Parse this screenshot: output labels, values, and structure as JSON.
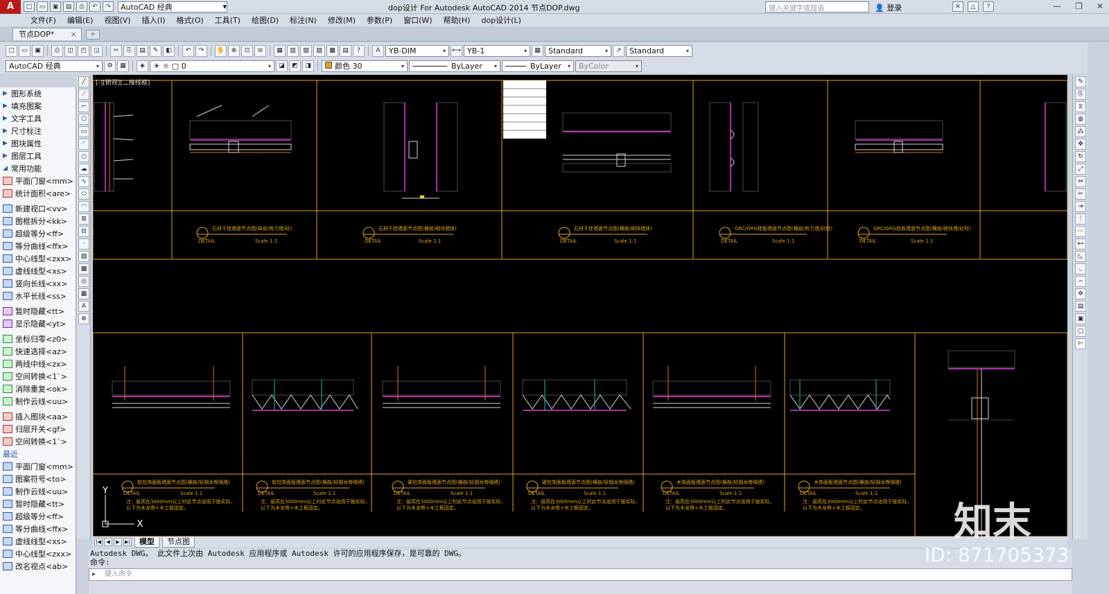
{
  "titlebar": {
    "workspace": "AutoCAD 经典",
    "title": "dop设计 For Autodesk AutoCAD 2014     节点DOP.dwg",
    "search_placeholder": "键入关键字或短语",
    "login": "登录",
    "logo": "A"
  },
  "menu": [
    "文件(F)",
    "编辑(E)",
    "视图(V)",
    "插入(I)",
    "格式(O)",
    "工具(T)",
    "绘图(D)",
    "标注(N)",
    "修改(M)",
    "参数(P)",
    "窗口(W)",
    "帮助(H)",
    "dop设计(L)"
  ],
  "doc_tab": {
    "label": "节点DOP*"
  },
  "styles": {
    "dim_style": "YB-DIM",
    "multileader_style": "YB-1",
    "table_style": "Standard",
    "text_style": "Standard"
  },
  "layers": {
    "workspace": "AutoCAD 经典",
    "current_layer": "0",
    "color": "颜色 30",
    "linetype": "ByLayer",
    "lineweight": "ByLayer",
    "plotstyle": "ByColor"
  },
  "left_panel": {
    "groups": [
      "图形系统",
      "填充图案",
      "文字工具",
      "尺寸标注",
      "图块属性",
      "图层工具"
    ],
    "common_label": "常用功能",
    "commands_a": [
      "平面门窗<mm>",
      "统计面积<are>"
    ],
    "commands_b": [
      "新建视口<vv>",
      "图框拆分<kk>",
      "超级等分<ff>",
      "等分曲线<ffx>",
      "中心线型<zxx>",
      "虚线线型<xs>",
      "竖向长线<xx>",
      "水平长线<ss>"
    ],
    "commands_c": [
      "暂时隐藏<tt>",
      "显示隐藏<yt>"
    ],
    "commands_d": [
      "坐标归零<z0>",
      "快速选择<az>",
      "两线中线<zx>",
      "空间转换<1`>",
      "消除重复<ok>",
      "制作云线<uu>"
    ],
    "commands_e": [
      "插入图块<aa>",
      "归层开关<gf>",
      "空间转换<1`>"
    ],
    "recent_label": "最近",
    "commands_recent": [
      "平面门窗<mm>",
      "图案符号<to>",
      "制作云线<uu>",
      "暂时隐藏<tt>",
      "超级等分<ff>",
      "等分曲线<ffx>",
      "虚线线型<xs>",
      "中心线型<zxx>",
      "改名视点<ab>"
    ]
  },
  "canvas": {
    "viewport_label": "[-][俯视][二维线框]",
    "detail_label": "DETAIL",
    "scale_label": "Scale 1:1",
    "ucs_y": "Y",
    "ucs_x": "X",
    "top_titles": [
      "石材干挂墙面节点图(纵剖/剪力墙/砼)",
      "石材干挂墙面节点图(横剖/砌块墙体)",
      "石材干挂墙面节点图(横剖/砌块墙体)",
      "GRC/GRG挂板墙面节点图(横剖/剪力墙/砼柱)",
      "GRC/GRG挂板墙面节点图(横剖/砌块墙/砼柱)"
    ],
    "bottom_titles": [
      "软包饰面板墙面节点图(横剖/轻钢龙骨隔墙)",
      "软包饰面板墙面节点图(横剖/轻钢龙骨隔墙)",
      "硬包饰面板墙面节点图(横剖/轻钢龙骨隔墙)",
      "硬包饰面板墙面节点图(横剖/轻钢龙骨隔墙)",
      "木饰面板墙面节点图(横剖/轻钢龙骨隔墙)",
      "木饰面板墙面节点图(横剖/轻钢龙骨隔墙)"
    ],
    "note_line1": "注：层高在3000mm以上时此节点适用于按实际，",
    "note_line2": "以下为木龙骨+木工板固定。"
  },
  "sheet_tabs": [
    "模型",
    "节点图"
  ],
  "command": {
    "line1": "Autodesk DWG。  此文件上次由 Autodesk 应用程序或 Autodesk 许可的应用程序保存，是可靠的 DWG。",
    "line2": "命令:",
    "placeholder": "键入命令"
  },
  "watermark": {
    "brand": "知末",
    "id": "ID: 871705373"
  },
  "colors": {
    "canvas_bg": "#000000",
    "cad_yellow": "#e3a521",
    "cad_magenta": "#e040e0",
    "cad_cyan": "#20c0c0",
    "ui_bg": "#d6dde6"
  }
}
